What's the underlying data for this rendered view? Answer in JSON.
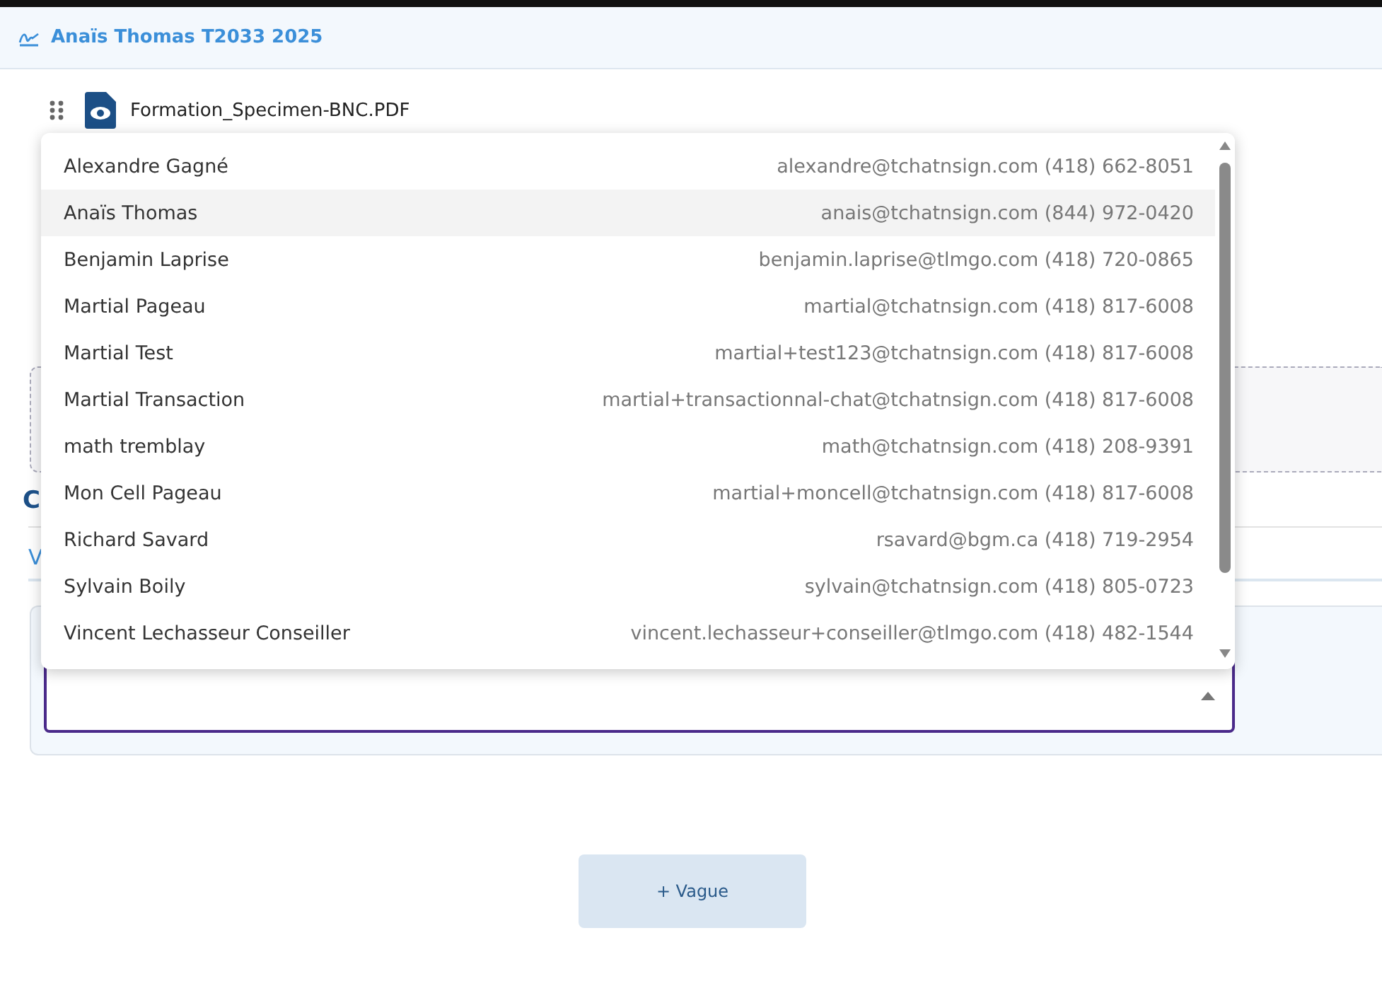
{
  "header": {
    "title": "Anaïs Thomas T2033 2025"
  },
  "document": {
    "filename": "Formation_Specimen-BNC.PDF"
  },
  "section": {
    "heading": "C",
    "tab": "V"
  },
  "recipient_select": {
    "expanded": true
  },
  "dropdown": {
    "options": [
      {
        "name": "Alexandre Gagné",
        "detail": "alexandre@tchatnsign.com (418) 662-8051",
        "selected": false
      },
      {
        "name": "Anaïs Thomas",
        "detail": "anais@tchatnsign.com (844) 972-0420",
        "selected": true
      },
      {
        "name": "Benjamin Laprise",
        "detail": "benjamin.laprise@tlmgo.com (418) 720-0865",
        "selected": false
      },
      {
        "name": "Martial Pageau",
        "detail": "martial@tchatnsign.com (418) 817-6008",
        "selected": false
      },
      {
        "name": "Martial Test",
        "detail": "martial+test123@tchatnsign.com (418) 817-6008",
        "selected": false
      },
      {
        "name": "Martial Transaction",
        "detail": "martial+transactionnal-chat@tchatnsign.com (418) 817-6008",
        "selected": false
      },
      {
        "name": "math tremblay",
        "detail": "math@tchatnsign.com (418) 208-9391",
        "selected": false
      },
      {
        "name": "Mon Cell Pageau",
        "detail": "martial+moncell@tchatnsign.com (418) 817-6008",
        "selected": false
      },
      {
        "name": "Richard Savard",
        "detail": "rsavard@bgm.ca (418) 719-2954",
        "selected": false
      },
      {
        "name": "Sylvain Boily",
        "detail": "sylvain@tchatnsign.com (418) 805-0723",
        "selected": false
      },
      {
        "name": "Vincent Lechasseur Conseiller",
        "detail": "vincent.lechasseur+conseiller@tlmgo.com (418) 482-1544",
        "selected": false
      }
    ]
  },
  "add_button": {
    "label": "+ Vague"
  }
}
